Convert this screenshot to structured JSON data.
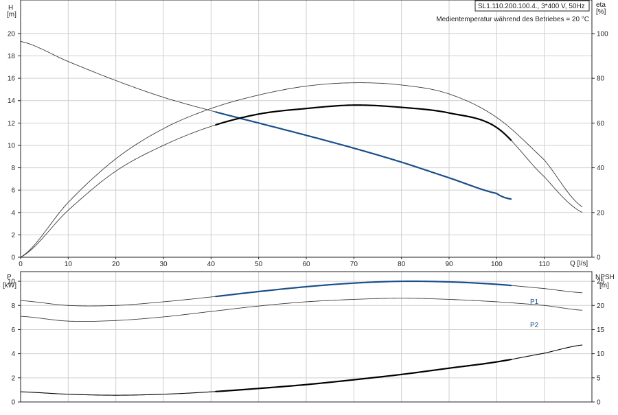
{
  "info": {
    "model": "SL1.110.200.100.4., 3*400 V, 50Hz",
    "note": "Medientemperatur während des Betriebes = 20 °C"
  },
  "colors": {
    "grid": "#cfcfcf",
    "curve_thin": "#3a3a3a",
    "curve_bold": "#000000",
    "operating": "#1a4f8a"
  },
  "chart_data": [
    {
      "type": "line",
      "panel": "top",
      "x_unit_label": "Q [l/s]",
      "xlim": [
        0,
        120
      ],
      "x_ticks": [
        0,
        10,
        20,
        30,
        40,
        50,
        60,
        70,
        80,
        90,
        100,
        110,
        120
      ],
      "y_label": "H",
      "y_unit": "[m]",
      "ylim": [
        0,
        23
      ],
      "y_ticks": [
        0,
        2,
        4,
        6,
        8,
        10,
        12,
        14,
        16,
        18,
        20
      ],
      "y2_label": "eta",
      "y2_unit": "[%]",
      "y2lim": [
        0,
        115
      ],
      "y2_ticks": [
        0,
        20,
        40,
        60,
        80,
        100
      ],
      "grid": true,
      "series": [
        {
          "key": "H",
          "axis": "left",
          "x": [
            0,
            10,
            20,
            30,
            40,
            50,
            60,
            70,
            80,
            90,
            100,
            103
          ],
          "y": [
            19.3,
            17.5,
            15.8,
            14.3,
            13.1,
            12.0,
            10.9,
            9.75,
            8.5,
            7.1,
            5.7,
            5.2
          ],
          "operating_range": [
            41,
            103
          ]
        },
        {
          "key": "eta-top",
          "axis": "right",
          "x": [
            0,
            10,
            20,
            30,
            40,
            50,
            60,
            70,
            80,
            90,
            100,
            110,
            118
          ],
          "y": [
            0,
            24.5,
            44,
            57.5,
            66.5,
            72.5,
            76.5,
            78,
            77,
            73,
            62.5,
            43.5,
            22.5
          ]
        },
        {
          "key": "eta",
          "axis": "right",
          "x": [
            0,
            10,
            20,
            30,
            40,
            50,
            60,
            70,
            80,
            90,
            100,
            110,
            118
          ],
          "y": [
            0,
            21,
            38.5,
            50,
            58.5,
            64,
            66.5,
            68,
            67,
            64.5,
            58,
            36,
            20
          ],
          "operating_range": [
            41,
            103
          ]
        }
      ]
    },
    {
      "type": "line",
      "panel": "bottom",
      "xlim": [
        0,
        120
      ],
      "x_ticks": [
        0,
        10,
        20,
        30,
        40,
        50,
        60,
        70,
        80,
        90,
        100,
        110,
        120
      ],
      "y_label": "P",
      "y_unit": "[kW]",
      "ylim": [
        0,
        10.8
      ],
      "y_ticks": [
        0,
        2,
        4,
        6,
        8,
        10
      ],
      "y2_label": "NPSH",
      "y2_unit": "[m]",
      "y2lim": [
        0,
        27
      ],
      "y2_ticks": [
        0,
        5,
        10,
        15,
        20,
        25
      ],
      "grid": true,
      "series": [
        {
          "key": "P1",
          "name": "P1",
          "axis": "left",
          "x": [
            0,
            10,
            20,
            30,
            40,
            50,
            60,
            70,
            80,
            90,
            100,
            110,
            118
          ],
          "y": [
            8.4,
            8.0,
            8.0,
            8.3,
            8.7,
            9.15,
            9.55,
            9.85,
            10.0,
            9.95,
            9.75,
            9.4,
            9.05
          ],
          "operating_range": [
            41,
            103
          ]
        },
        {
          "key": "P2",
          "name": "P2",
          "axis": "left",
          "x": [
            0,
            10,
            20,
            30,
            40,
            50,
            60,
            70,
            80,
            90,
            100,
            110,
            118
          ],
          "y": [
            7.1,
            6.7,
            6.75,
            7.05,
            7.5,
            7.95,
            8.3,
            8.5,
            8.6,
            8.5,
            8.3,
            8.0,
            7.6
          ]
        },
        {
          "key": "NPSH",
          "axis": "right",
          "x": [
            0,
            10,
            20,
            30,
            40,
            50,
            60,
            70,
            80,
            90,
            100,
            110,
            118
          ],
          "y": [
            2.1,
            1.6,
            1.4,
            1.6,
            2.1,
            2.8,
            3.6,
            4.6,
            5.7,
            7.0,
            8.3,
            10.1,
            11.8
          ],
          "operating_range": [
            41,
            103
          ]
        }
      ]
    }
  ]
}
